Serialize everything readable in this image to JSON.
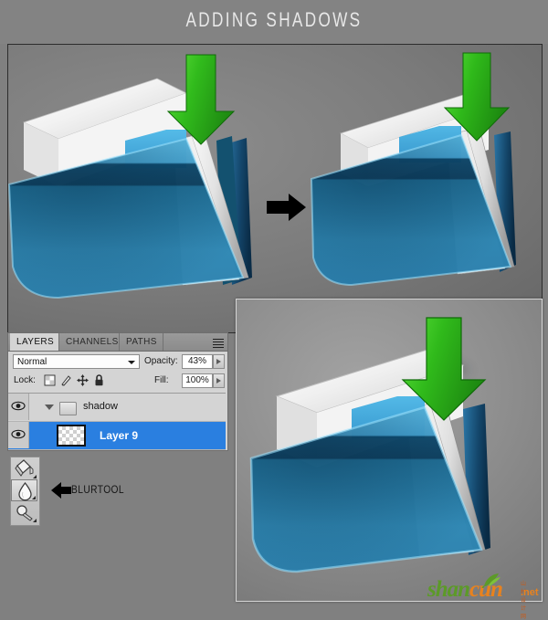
{
  "header": {
    "title": "ADDING SHADOWS"
  },
  "canvas": {
    "name": "photoshop-canvas",
    "background": "#7a7a7a",
    "before_after_arrow": "black-right-arrow",
    "items": [
      {
        "label": "folder-icon-before",
        "note": "blue glossy folder with white sheets, no shadows"
      },
      {
        "label": "folder-icon-after",
        "note": "blue glossy folder with shadows applied"
      }
    ],
    "green_arrow_color": "#35b71e",
    "black_arrow_color": "#000000"
  },
  "inset": {
    "name": "detail-preview",
    "note": "zoomed detail of finished folder with shadows"
  },
  "layers_panel": {
    "tabs": [
      {
        "label": "LAYERS",
        "active": true
      },
      {
        "label": "CHANNELS",
        "active": false
      },
      {
        "label": "PATHS",
        "active": false
      }
    ],
    "menu_icon": "panel-menu-icon",
    "blend_mode": "Normal",
    "opacity_label": "Opacity:",
    "opacity_value": "43%",
    "lock_label": "Lock:",
    "lock_icons": [
      "lock-transparent-pixels-icon",
      "lock-image-pixels-icon",
      "lock-position-icon",
      "lock-all-icon"
    ],
    "fill_label": "Fill:",
    "fill_value": "100%",
    "layers": [
      {
        "name": "shadow",
        "type": "group",
        "visible": true,
        "expanded": true,
        "selected": false
      },
      {
        "name": "Layer 9",
        "type": "layer",
        "visible": true,
        "selected": true,
        "thumbnail": "transparent-checkerboard"
      }
    ],
    "selection_color": "#2a7fe0"
  },
  "tool_callout": {
    "tools": [
      {
        "name": "paint-bucket-tool",
        "active": false
      },
      {
        "name": "blur-tool",
        "active": true
      },
      {
        "name": "dodge-tool",
        "active": false
      }
    ],
    "arrow": "left-pointing-arrow",
    "label": "BLURTOOL"
  },
  "watermark": {
    "part1": "shan",
    "part2": "cun",
    "domain": ".net",
    "cn_text": "山村设计网",
    "color1": "#5c9a28",
    "color2": "#e8821e"
  }
}
